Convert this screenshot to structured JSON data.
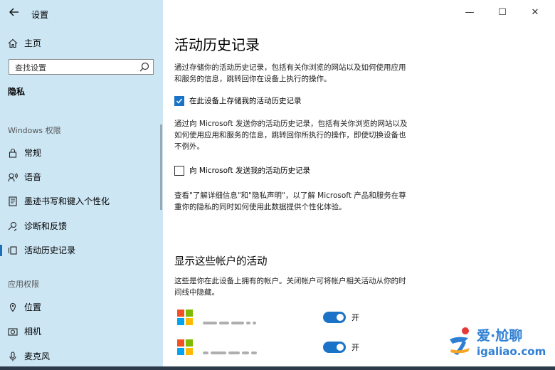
{
  "app": {
    "title": "设置"
  },
  "window_controls": {
    "minimize": "—",
    "maximize": "☐",
    "close": "✕"
  },
  "sidebar": {
    "home_label": "主页",
    "search_placeholder": "查找设置",
    "section_title": "隐私",
    "windows_group_label": "Windows 权限",
    "windows_items": [
      {
        "label": "常规",
        "icon": "lock-icon"
      },
      {
        "label": "语音",
        "icon": "speech-icon"
      },
      {
        "label": "墨迹书写和键入个性化",
        "icon": "inking-icon"
      },
      {
        "label": "诊断和反馈",
        "icon": "diagnostics-icon"
      },
      {
        "label": "活动历史记录",
        "icon": "activity-history-icon",
        "active": true
      }
    ],
    "app_group_label": "应用权限",
    "app_items": [
      {
        "label": "位置",
        "icon": "location-icon"
      },
      {
        "label": "相机",
        "icon": "camera-icon"
      },
      {
        "label": "麦克风",
        "icon": "microphone-icon"
      }
    ]
  },
  "main": {
    "title": "活动历史记录",
    "intro": "通过存储你的活动历史记录，包括有关你浏览的网站以及如何使用应用和服务的信息，跳转回你在设备上执行的操作。",
    "store_checkbox": {
      "label": "在此设备上存储我的活动历史记录",
      "checked": true
    },
    "send_desc": "通过向 Microsoft 发送你的活动历史记录，包括有关你浏览的网站以及如何使用应用和服务的信息，跳转回你所执行的操作，即使切换设备也不例外。",
    "send_checkbox": {
      "label": "向 Microsoft 发送我的活动历史记录",
      "checked": false
    },
    "privacy_note": "查看\"了解详细信息\"和\"隐私声明\"，以了解 Microsoft 产品和服务在尊重你的隐私的同时如何使用此数据提供个性化体验。",
    "accounts_title": "显示这些帐户的活动",
    "accounts_desc": "这些是你在此设备上拥有的帐户。关闭帐户可将帐户相关活动从你的时间线中隐藏。",
    "accounts": [
      {
        "toggle_label": "开",
        "on": true
      },
      {
        "toggle_label": "开",
        "on": true
      }
    ]
  },
  "watermark": {
    "cn": "爱·尬聊",
    "en": "igaliao.com"
  },
  "colors": {
    "sidebar_bg": "#cce6f4",
    "accent": "#1a73c7",
    "watermark": "#2e7fd3"
  }
}
